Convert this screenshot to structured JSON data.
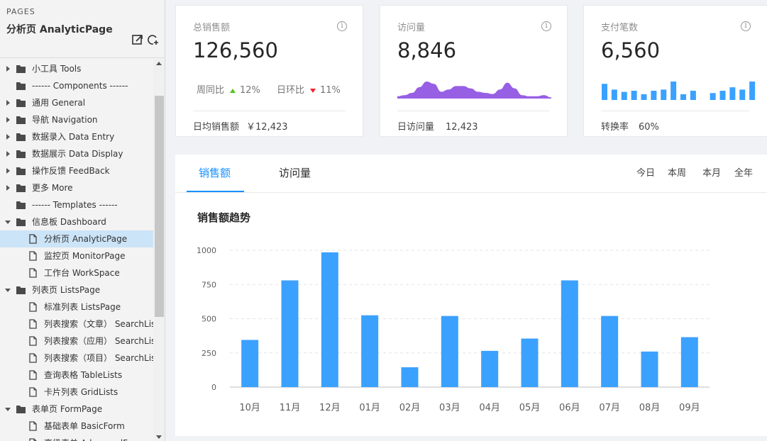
{
  "sidebar": {
    "section_label": "PAGES",
    "title": "分析页 AnalyticPage",
    "tree": [
      {
        "label": "小工具 Tools",
        "type": "folder",
        "level": 0,
        "expanded": false
      },
      {
        "label": "------ Components ------",
        "type": "folder",
        "level": 0,
        "expanded": null
      },
      {
        "label": "通用 General",
        "type": "folder",
        "level": 0,
        "expanded": false
      },
      {
        "label": "导航 Navigation",
        "type": "folder",
        "level": 0,
        "expanded": false
      },
      {
        "label": "数据录入 Data Entry",
        "type": "folder",
        "level": 0,
        "expanded": false
      },
      {
        "label": "数据展示 Data Display",
        "type": "folder",
        "level": 0,
        "expanded": false
      },
      {
        "label": "操作反馈 FeedBack",
        "type": "folder",
        "level": 0,
        "expanded": false
      },
      {
        "label": "更多 More",
        "type": "folder",
        "level": 0,
        "expanded": false
      },
      {
        "label": "------ Templates ------",
        "type": "folder",
        "level": 0,
        "expanded": null
      },
      {
        "label": "信息板 Dashboard",
        "type": "folder",
        "level": 0,
        "expanded": true
      },
      {
        "label": "分析页 AnalyticPage",
        "type": "page",
        "level": 1,
        "selected": true
      },
      {
        "label": "监控页 MonitorPage",
        "type": "page",
        "level": 1
      },
      {
        "label": "工作台 WorkSpace",
        "type": "page",
        "level": 1
      },
      {
        "label": "列表页 ListsPage",
        "type": "folder",
        "level": 0,
        "expanded": true
      },
      {
        "label": "标准列表 ListsPage",
        "type": "page",
        "level": 1
      },
      {
        "label": "列表搜索（文章） SearchList",
        "type": "page",
        "level": 1
      },
      {
        "label": "列表搜索（应用） SearchList",
        "type": "page",
        "level": 1
      },
      {
        "label": "列表搜索（项目） SearchList",
        "type": "page",
        "level": 1
      },
      {
        "label": "查询表格 TableLists",
        "type": "page",
        "level": 1
      },
      {
        "label": "卡片列表 GridLists",
        "type": "page",
        "level": 1
      },
      {
        "label": "表单页 FormPage",
        "type": "folder",
        "level": 0,
        "expanded": true
      },
      {
        "label": "基础表单 BasicForm",
        "type": "page",
        "level": 1
      },
      {
        "label": "高级表单 AdvancedForm",
        "type": "page",
        "level": 1
      }
    ]
  },
  "cards": {
    "sales": {
      "title": "总销售额",
      "value": "126,560",
      "wow_label": "周同比",
      "wow_value": "12%",
      "dod_label": "日环比",
      "dod_value": "11%",
      "footer_label": "日均销售额",
      "footer_value": "￥12,423"
    },
    "visits": {
      "title": "访问量",
      "value": "8,846",
      "footer_label": "日访问量",
      "footer_value": "12,423"
    },
    "payments": {
      "title": "支付笔数",
      "value": "6,560",
      "footer_label": "转换率",
      "footer_value": "60%"
    }
  },
  "panel": {
    "tabs": [
      "销售额",
      "访问量"
    ],
    "active_tab": 0,
    "ranges": [
      "今日",
      "本周",
      "本月",
      "全年"
    ],
    "chart_title": "销售额趋势"
  },
  "colors": {
    "accent": "#1890ff",
    "bar": "#3ba1ff",
    "area": "#975fe4",
    "up": "#52c41a",
    "down": "#f5222d"
  },
  "mini_area": {
    "values": [
      2,
      3,
      5,
      10,
      15,
      13,
      6,
      8,
      11,
      11,
      9,
      6,
      5,
      4,
      8,
      14,
      9,
      3,
      2,
      2,
      3,
      1
    ]
  },
  "mini_bar": {
    "values": [
      7,
      4.5,
      3.5,
      4,
      2.5,
      4,
      4.5,
      8,
      2.5,
      4,
      0,
      3,
      4,
      5.5,
      4.5,
      8
    ]
  },
  "chart_data": {
    "type": "bar",
    "title": "销售额趋势",
    "categories": [
      "10月",
      "11月",
      "12月",
      "01月",
      "02月",
      "03月",
      "04月",
      "05月",
      "06月",
      "07月",
      "08月",
      "09月"
    ],
    "values": [
      345,
      780,
      985,
      525,
      145,
      520,
      265,
      355,
      780,
      520,
      260,
      365
    ],
    "ylim": [
      0,
      1000
    ],
    "yticks": [
      0,
      250,
      500,
      750,
      1000
    ],
    "grid": true
  }
}
